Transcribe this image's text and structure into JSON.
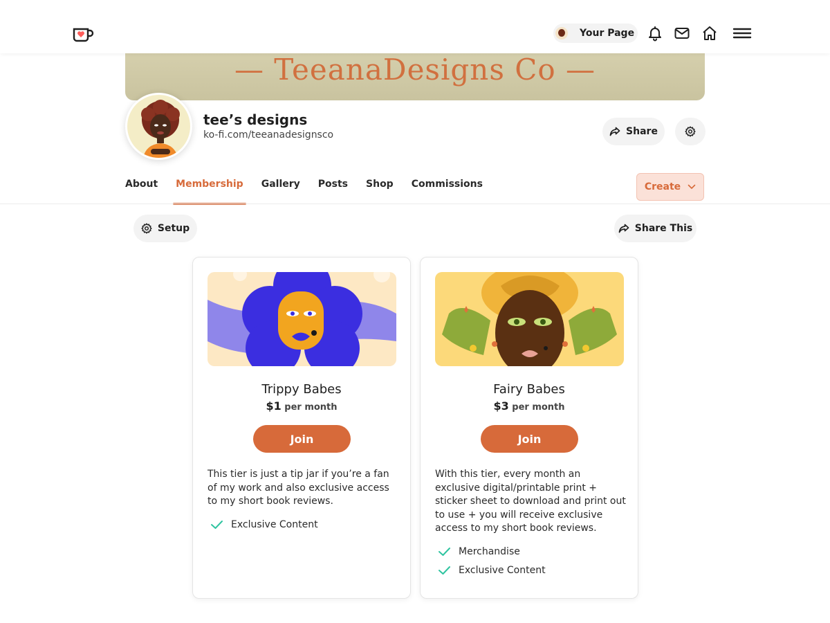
{
  "nav": {
    "your_page_label": "Your Page"
  },
  "banner": {
    "title": "— TeeanaDesigns Co —"
  },
  "profile": {
    "name": "tee’s designs",
    "url": "ko-fi.com/teeanadesignsco",
    "share_label": "Share"
  },
  "tabs": [
    {
      "label": "About",
      "active": false
    },
    {
      "label": "Membership",
      "active": true
    },
    {
      "label": "Gallery",
      "active": false
    },
    {
      "label": "Posts",
      "active": false
    },
    {
      "label": "Shop",
      "active": false
    },
    {
      "label": "Commissions",
      "active": false
    }
  ],
  "create_label": "Create",
  "setup_label": "Setup",
  "share_this_label": "Share This",
  "tiers": [
    {
      "name": "Trippy Babes",
      "price": "$1",
      "period": "per month",
      "join_label": "Join",
      "description": "This tier is just a tip jar if you’re a fan of my work and also exclusive access to my short book reviews.",
      "features": [
        "Exclusive Content"
      ]
    },
    {
      "name": "Fairy Babes",
      "price": "$3",
      "period": "per month",
      "join_label": "Join",
      "description": "With this tier, every month an exclusive digital/printable print + sticker sheet to download and print out to use + you will receive exclusive access to my short book reviews.",
      "features": [
        "Merchandise",
        "Exclusive Content"
      ]
    }
  ],
  "colors": {
    "accent": "#d76a3a",
    "check": "#2fc4a0"
  },
  "icons": {
    "logo": "kofi-cup-logo",
    "notifications": "bell-icon",
    "messages": "mail-icon",
    "home": "home-icon",
    "menu": "hamburger-menu-icon",
    "share": "share-arrow-icon",
    "settings": "gear-icon",
    "dropdown": "chevron-down-icon",
    "feature": "check-icon"
  }
}
